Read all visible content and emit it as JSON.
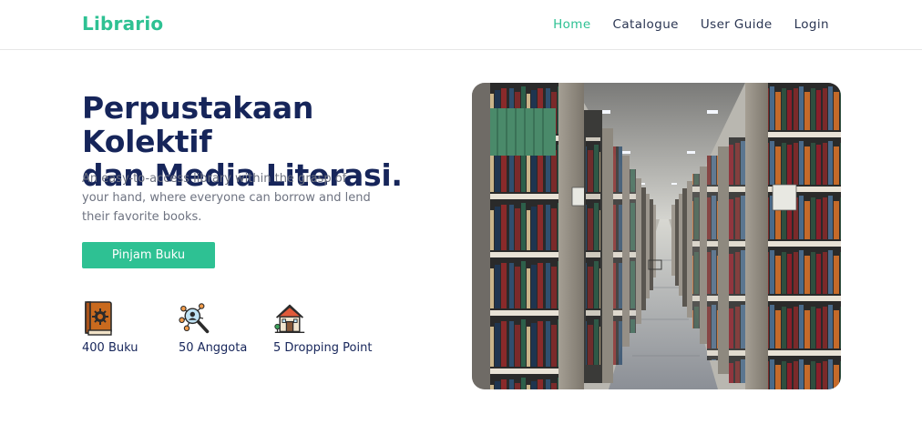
{
  "navbar": {
    "brand": "Librario",
    "links": [
      {
        "label": "Home",
        "active": true
      },
      {
        "label": "Catalogue",
        "active": false
      },
      {
        "label": "User Guide",
        "active": false
      },
      {
        "label": "Login",
        "active": false
      }
    ]
  },
  "hero": {
    "title_line1": "Perpustakaan Kolektif",
    "title_line2": "dan Media Literasi.",
    "description": "An easy-to-access library within the grasp of your hand, where everyone can borrow and lend their favorite books.",
    "cta_label": "Pinjam Buku"
  },
  "stats": [
    {
      "icon": "book-icon",
      "label": "400 Buku"
    },
    {
      "icon": "members-network-icon",
      "label": "50 Anggota"
    },
    {
      "icon": "house-icon",
      "label": "5 Dropping Point"
    }
  ],
  "colors": {
    "accent": "#2ec193",
    "heading": "#16255a",
    "body_text": "#6e7381"
  }
}
